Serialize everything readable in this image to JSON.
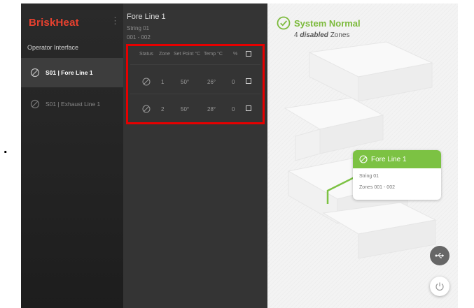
{
  "sidebar": {
    "brand": "BriskHeat",
    "kebab": "⋮",
    "operator_label": "Operator Interface",
    "items": [
      {
        "label": "S01 | Fore Line 1"
      },
      {
        "label": "S01 | Exhaust Line 1"
      }
    ]
  },
  "panel": {
    "title": "Fore Line 1",
    "string": "String 01",
    "range": "001 - 002",
    "headers": {
      "status": "Status",
      "zone": "Zone",
      "setpoint": "Set Point °C",
      "temp": "Temp °C",
      "pct": "%"
    },
    "rows": [
      {
        "zone": "1",
        "setpoint": "50°",
        "temp": "26°",
        "pct": "0"
      },
      {
        "zone": "2",
        "setpoint": "50°",
        "temp": "28°",
        "pct": "0"
      }
    ]
  },
  "status": {
    "title": "System Normal",
    "count": "4",
    "disabled_word": "disabled",
    "zones_word": "Zones"
  },
  "map_card": {
    "title": "Fore Line 1",
    "string": "String 01",
    "zones": "Zones 001 - 002"
  },
  "annotation": {
    "leader_dot": "."
  },
  "colors": {
    "brand": "#e8412f",
    "accent_green": "#7cc243",
    "highlight_red": "#e60000"
  },
  "icons": {
    "disabled": "disabled-circle-icon",
    "usb": "usb-icon",
    "power": "power-icon",
    "check": "check-circle-icon"
  }
}
